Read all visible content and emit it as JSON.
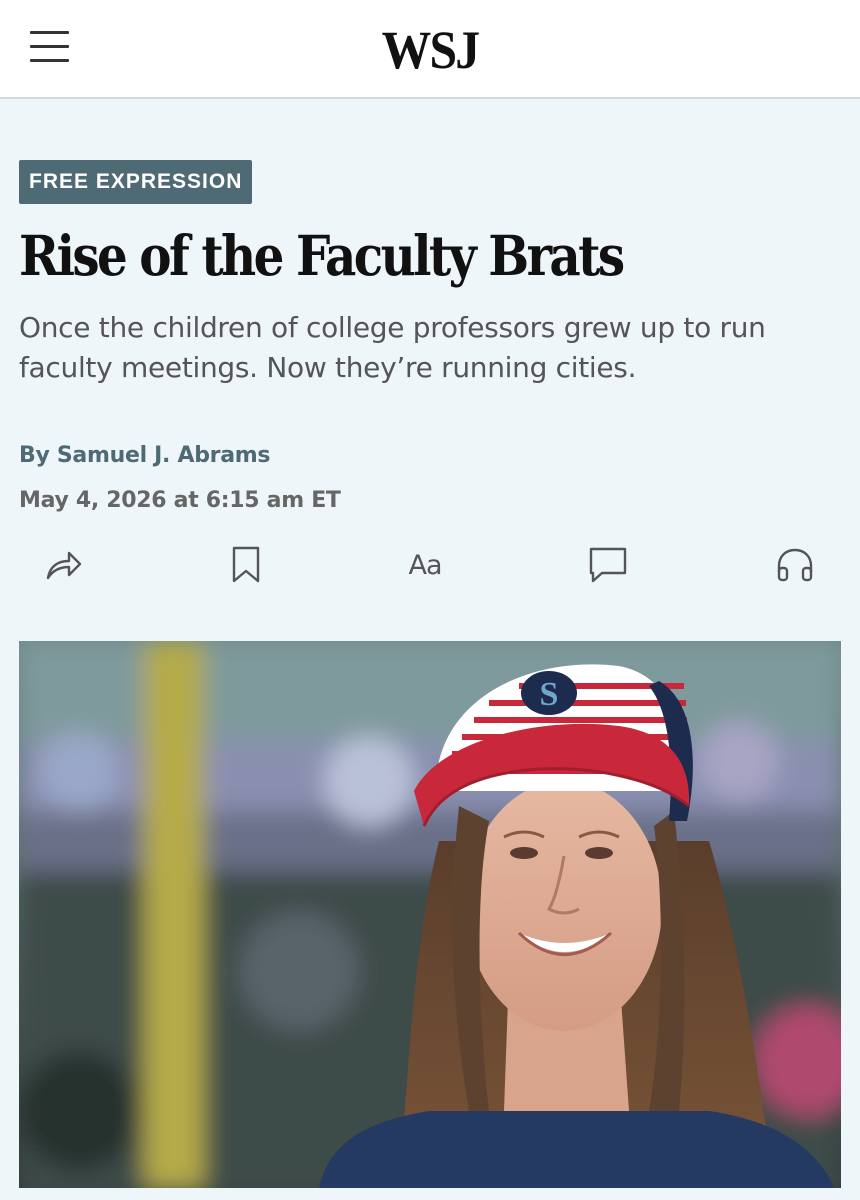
{
  "header": {
    "logo_text": "WSJ",
    "menu_icon": "hamburger-menu-icon"
  },
  "article": {
    "section_badge": "FREE EXPRESSION",
    "headline": "Rise of the Faculty Brats",
    "dek": "Once the children of college professors grew up to run faculty meetings. Now they’re running cities.",
    "byline": "By Samuel J. Abrams",
    "dateline": "May 4, 2026 at 6:15 am ET"
  },
  "actions": [
    {
      "name": "share",
      "icon": "share-arrow-icon"
    },
    {
      "name": "save",
      "icon": "bookmark-icon"
    },
    {
      "name": "text-size",
      "label": "Aa",
      "icon": "text-size-icon"
    },
    {
      "name": "comments",
      "icon": "comment-bubble-icon"
    },
    {
      "name": "listen",
      "icon": "headphones-icon"
    }
  ],
  "colors": {
    "page_background": "#eff6fa",
    "badge_background": "#4e6a75",
    "byline": "#4e6a75",
    "cap_red": "#c8283a",
    "cap_navy": "#1d2b4f"
  }
}
